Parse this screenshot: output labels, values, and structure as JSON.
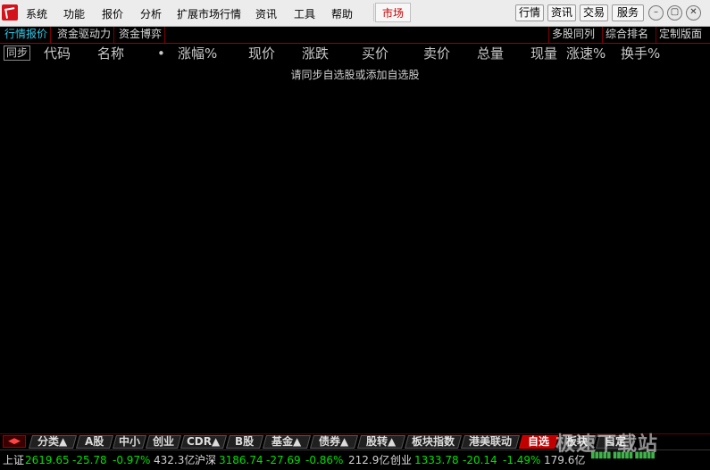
{
  "menubar": {
    "items": [
      "系统",
      "功能",
      "报价",
      "分析",
      "扩展市场行情",
      "资讯",
      "工具",
      "帮助"
    ],
    "market": "市场",
    "right_buttons": [
      "行情",
      "资讯",
      "交易",
      "服务"
    ],
    "window_controls": [
      "minimize-icon",
      "restore-icon",
      "close-icon"
    ]
  },
  "tabs": {
    "left": [
      "行情报价",
      "资金驱动力",
      "资金博弈"
    ],
    "right": [
      "多股同列",
      "综合排名",
      "定制版面"
    ]
  },
  "header": {
    "sync": "同步",
    "columns": [
      "代码",
      "名称",
      "•",
      "涨幅%",
      "现价",
      "涨跌",
      "买价",
      "卖价",
      "总量",
      "现量",
      "涨速%",
      "换手%"
    ]
  },
  "empty_message": "请同步自选股或添加自选股",
  "bottom_tabs": [
    "分类▲",
    "A股",
    "中小",
    "创业",
    "CDR▲",
    "B股",
    "基金▲",
    "债券▲",
    "股转▲",
    "板块指数",
    "港美联动",
    "自选",
    "板块",
    "自定"
  ],
  "status": {
    "sh": {
      "label": "上证",
      "value": "2619.65",
      "change": "-25.78",
      "pct": "-0.97%",
      "amount": "432.3亿"
    },
    "hs": {
      "label": "沪深",
      "value": "3186.74",
      "change": "-27.69",
      "pct": "-0.86%",
      "amount": "212.9亿"
    },
    "cy": {
      "label": "创业",
      "value": "1333.78",
      "change": "-20.14",
      "pct": "-1.49%",
      "amount": "179.6亿"
    }
  },
  "watermark": "极速下载站",
  "colors": {
    "down": "#00e000",
    "active_tab": "#31c8e6",
    "market": "#cc0000",
    "selected_tab": "#c00000"
  }
}
